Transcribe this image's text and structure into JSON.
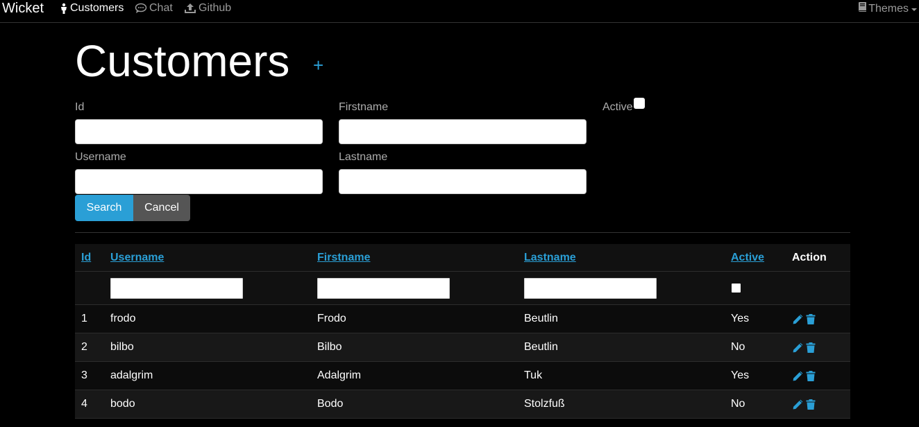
{
  "nav": {
    "brand": "Wicket",
    "links": [
      {
        "label": "Customers",
        "icon": "person-icon",
        "active": true
      },
      {
        "label": "Chat",
        "icon": "chat-icon",
        "active": false
      },
      {
        "label": "Github",
        "icon": "upload-icon",
        "active": false
      }
    ],
    "themes": {
      "label": "Themes",
      "icon": "book-icon"
    }
  },
  "page": {
    "title": "Customers",
    "add_label": "+"
  },
  "form": {
    "id_label": "Id",
    "firstname_label": "Firstname",
    "active_label": "Active",
    "username_label": "Username",
    "lastname_label": "Lastname",
    "search_label": "Search",
    "cancel_label": "Cancel"
  },
  "table": {
    "headers": {
      "id": "Id",
      "username": "Username",
      "firstname": "Firstname",
      "lastname": "Lastname",
      "active": "Active",
      "action": "Action"
    },
    "rows": [
      {
        "id": "1",
        "username": "frodo",
        "firstname": "Frodo",
        "lastname": "Beutlin",
        "active": "Yes"
      },
      {
        "id": "2",
        "username": "bilbo",
        "firstname": "Bilbo",
        "lastname": "Beutlin",
        "active": "No"
      },
      {
        "id": "3",
        "username": "adalgrim",
        "firstname": "Adalgrim",
        "lastname": "Tuk",
        "active": "Yes"
      },
      {
        "id": "4",
        "username": "bodo",
        "firstname": "Bodo",
        "lastname": "Stolzfuß",
        "active": "No"
      }
    ]
  },
  "colors": {
    "accent": "#2a9fd6",
    "background": "#000000",
    "cancel": "#555555"
  }
}
